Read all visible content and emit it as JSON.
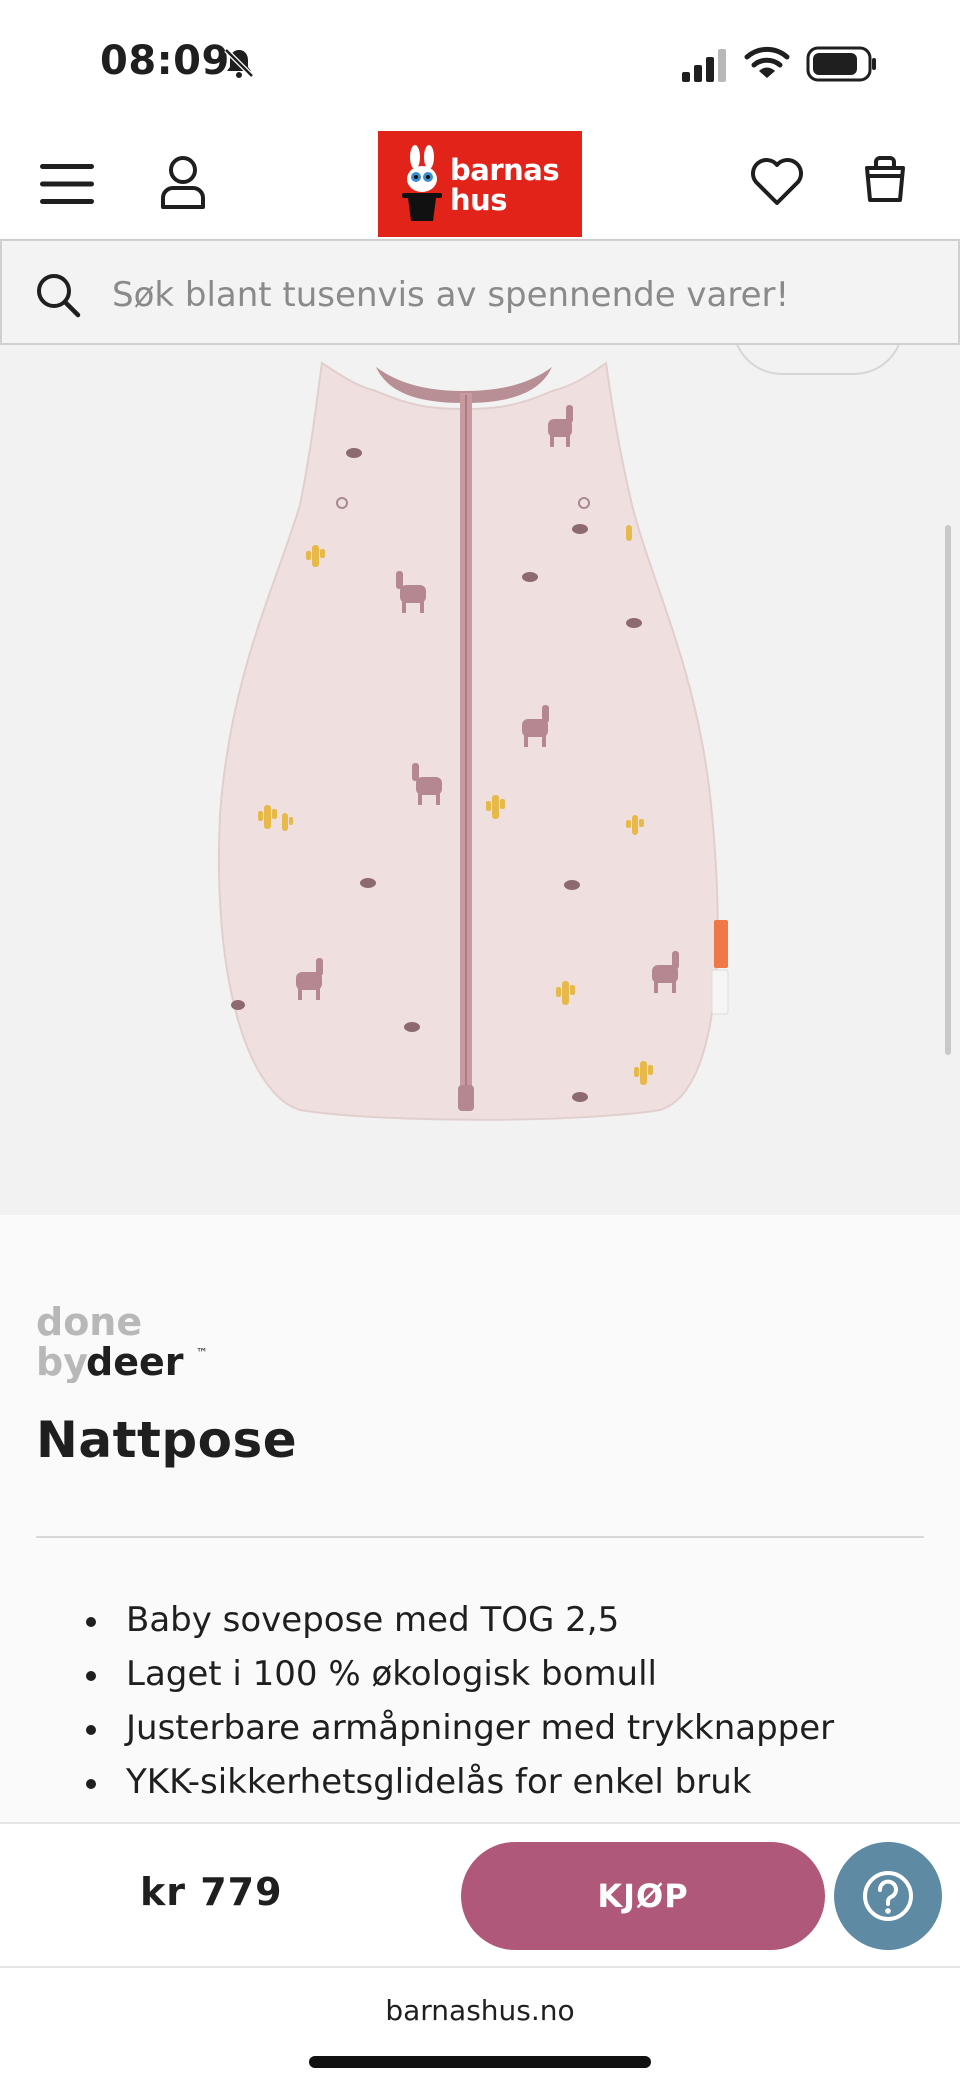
{
  "status_bar": {
    "time": "08:09",
    "icons": [
      "bell-slash-icon",
      "signal-icon",
      "wifi-icon",
      "battery-icon"
    ]
  },
  "header": {
    "icons": [
      "menu-icon",
      "user-icon",
      "heart-icon",
      "bag-icon"
    ],
    "logo": {
      "line1": "barnas",
      "line2": "hus"
    }
  },
  "search": {
    "placeholder": "Søk blant tusenvis av spennende varer!",
    "icon": "search-icon"
  },
  "product": {
    "brand": {
      "line1": "done",
      "line2a": "by",
      "line2b": "deer",
      "mark": "™"
    },
    "title": "Nattpose",
    "features": [
      "Baby sovepose med TOG 2,5",
      "Laget i 100 % økologisk bomull",
      "Justerbare armåpninger med trykknapper",
      "YKK-sikkerhetsglidelås for enkel bruk"
    ]
  },
  "buy_bar": {
    "price": "kr 779",
    "buy_label": "KJØP",
    "help_icon": "help-icon"
  },
  "browser": {
    "url": "barnashus.no"
  },
  "colors": {
    "brand_red": "#e2231a",
    "buy_button": "#b0587a",
    "help_button": "#5f8aa4",
    "sleeping_bag": "#efe0df",
    "zipper": "#c89aa0",
    "llama": "#b58790",
    "cactus": "#e6b94a"
  }
}
